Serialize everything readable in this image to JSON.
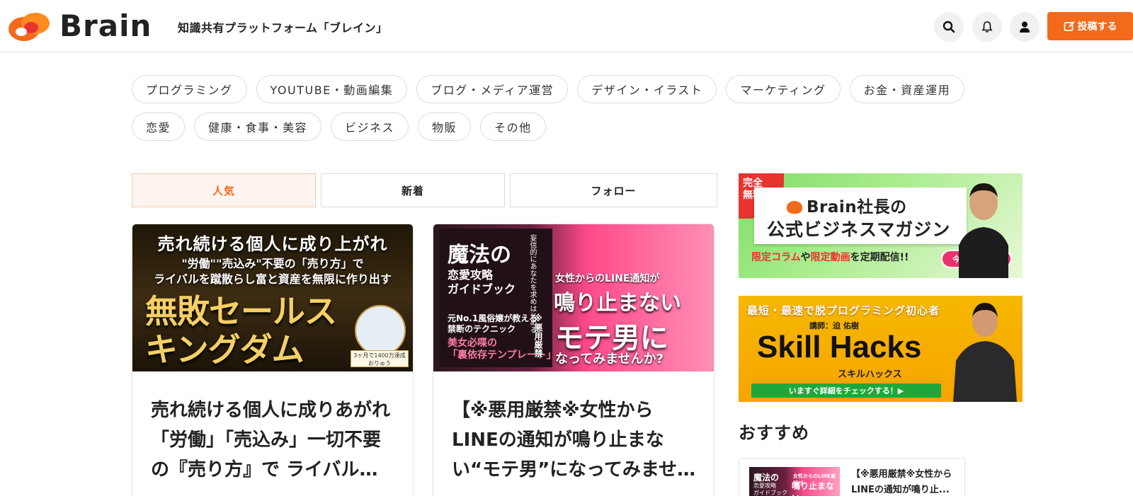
{
  "header": {
    "logo_text": "Brain",
    "tagline": "知識共有プラットフォーム「ブレイン」",
    "post_label": "投稿する",
    "icons": [
      "search-icon",
      "bell-icon",
      "user-icon",
      "edit-icon"
    ]
  },
  "categories": {
    "row1": [
      "プログラミング",
      "YOUTUBE・動画編集",
      "ブログ・メディア運営",
      "デザイン・イラスト",
      "マーケティング",
      "お金・資産運用"
    ],
    "row2": [
      "恋愛",
      "健康・食事・美容",
      "ビジネス",
      "物販",
      "その他"
    ]
  },
  "tabs": [
    {
      "label": "人気",
      "active": true
    },
    {
      "label": "新着",
      "active": false
    },
    {
      "label": "フォロー",
      "active": false
    }
  ],
  "cards": [
    {
      "thumb": {
        "line1": "売れ続ける個人に成り上がれ",
        "line2": "\"労働\"\"売込み\"不要の「売り方」で",
        "line3": "ライバルを蹴散らし富と資産を無限に作り出す",
        "big1": "無敗セールス",
        "big2": "キングダム",
        "badge1": "3ヶ月で1400万達成",
        "badge2": "おりゅう"
      },
      "title": "売れ続ける個人に成りあがれ 「労働」「売込み」一切不要の『売り方』で ライバルを蹴散らし富と資産を無限に作り出す"
    },
    {
      "thumb": {
        "main1": "魔法の",
        "main2a": "恋愛攻略",
        "main2b": "ガイドブック",
        "vert1": "妄信的にあなたを求めはじめる",
        "small1a": "元No.1風俗嬢が教える",
        "small1b": "禁断のテクニック",
        "small2a": "美女必喋の",
        "small2b": "「裏依存テンプレート」",
        "vert2": "※悪用厳禁",
        "r1": "女性からのLINE通知が",
        "r2": "鳴り止まない",
        "r3": "モテ男に",
        "r4": "なってみませんか?"
      },
      "title": "【※悪用厳禁※女性からLINEの通知が鳴り止まない“モテ男”になってみませんか?"
    }
  ],
  "banners": {
    "b1": {
      "ribbon1": "完全",
      "ribbon2": "無料",
      "line1": "Brain社長の",
      "line2": "公式ビジネスマガジン",
      "sub_a": "限定コラム",
      "sub_b": "や",
      "sub_c": "限定動画",
      "sub_d": "を定期配信!!",
      "cta": "今すぐ登録 ➔"
    },
    "b2": {
      "line1": "最短・最速で脱プログラミング初心者",
      "line2": "講師：迫 佑樹",
      "line3": "Skill Hacks",
      "line4": "スキルハックス",
      "cta": "いますぐ詳細をチェックする！▶"
    }
  },
  "recommend": {
    "title": "おすすめ",
    "item": {
      "thumb_a": "魔法の",
      "thumb_b1": "恋愛攻略",
      "thumb_b2": "ガイドブック",
      "thumb_c": "女性からのLINE通知が",
      "thumb_d": "鳴り止まない",
      "text": "【※悪用厳禁※女性からLINEの通知が鳴り止..."
    }
  },
  "colors": {
    "accent": "#f36a1b",
    "border": "#dcdcdc",
    "tab_active_bg": "#fff4ee"
  }
}
